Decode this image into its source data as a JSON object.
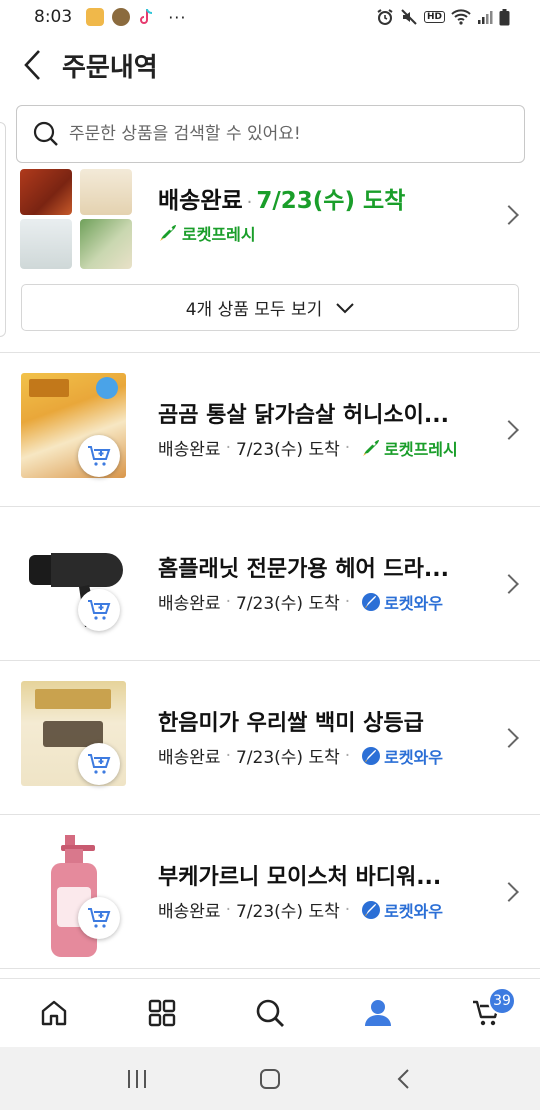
{
  "status_bar": {
    "time": "8:03",
    "overflow": "···",
    "hd": "HD",
    "icons": [
      "gallery-app-icon",
      "profile-app-icon",
      "tiktok-icon",
      "alarm-icon",
      "mute-icon",
      "wifi-icon",
      "signal-icon",
      "battery-icon"
    ]
  },
  "header": {
    "title": "주문내역",
    "back_icon": "chevron-left-icon"
  },
  "search": {
    "placeholder": "주문한 상품을 검색할 수 있어요!",
    "value": "",
    "icon": "search-icon"
  },
  "order_group": {
    "status": "배송완료",
    "arrival": "7/23(수) 도착",
    "delivery_type": "로켓프레시",
    "view_all_label": "4개 상품 모두 보기"
  },
  "orders": [
    {
      "name": "곰곰 통살 닭가슴살 허니소이...",
      "status": "배송완료",
      "arrival": "7/23(수) 도착",
      "badge": "로켓프레시",
      "badge_type": "fresh"
    },
    {
      "name": "홈플래닛 전문가용 헤어 드라...",
      "status": "배송완료",
      "arrival": "7/23(수) 도착",
      "badge": "로켓와우",
      "badge_type": "wow"
    },
    {
      "name": "한음미가 우리쌀 백미 상등급",
      "status": "배송완료",
      "arrival": "7/23(수) 도착",
      "badge": "로켓와우",
      "badge_type": "wow"
    },
    {
      "name": "부케가르니 모이스처 바디워...",
      "status": "배송완료",
      "arrival": "7/23(수) 도착",
      "badge": "로켓와우",
      "badge_type": "wow"
    }
  ],
  "bottom_nav": {
    "items": [
      "home-icon",
      "category-grid-icon",
      "search-icon",
      "my-account-icon",
      "cart-icon"
    ],
    "cart_count": "39"
  },
  "colors": {
    "fresh_green": "#1a9e2a",
    "wow_blue": "#2b6fd6",
    "accent_blue": "#3d7be0"
  }
}
